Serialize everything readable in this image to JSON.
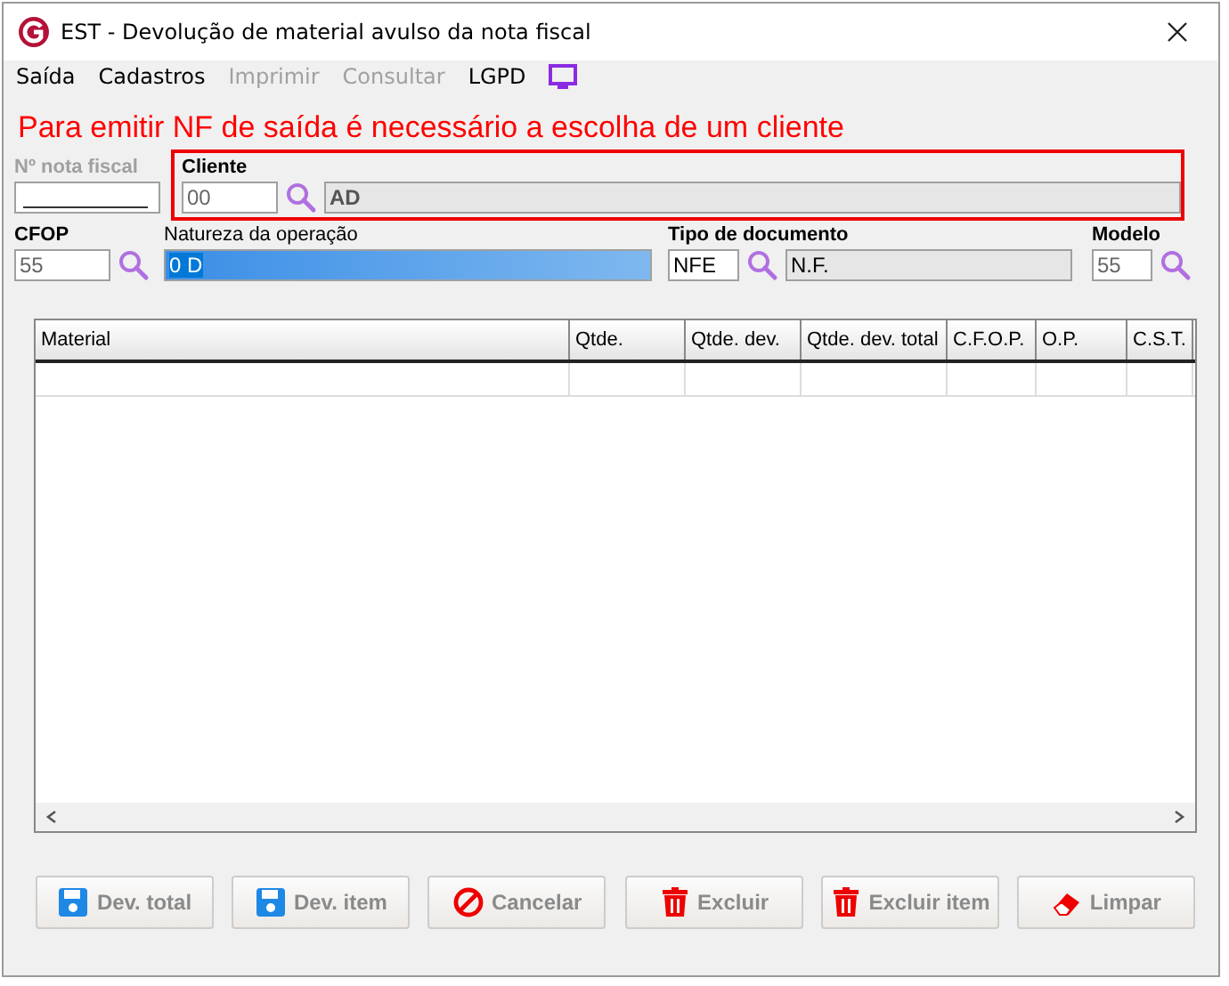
{
  "window": {
    "title": "EST - Devolução de material avulso da nota fiscal"
  },
  "menu": [
    {
      "label": "Saída",
      "disabled": false
    },
    {
      "label": "Cadastros",
      "disabled": false
    },
    {
      "label": "Imprimir",
      "disabled": true
    },
    {
      "label": "Consultar",
      "disabled": true
    },
    {
      "label": "LGPD",
      "disabled": false
    }
  ],
  "message": "Para emitir NF de saída é necessário a escolha de um cliente",
  "nota_fiscal": {
    "label": "Nº nota fiscal",
    "disabled": true
  },
  "cliente": {
    "label": "Cliente",
    "code": "00",
    "name": "AD"
  },
  "cfop": {
    "label": "CFOP",
    "value": "55"
  },
  "natureza": {
    "label": "Natureza da operação",
    "value": "0 D"
  },
  "tipo_documento": {
    "label": "Tipo de documento",
    "code": "NFE",
    "name": "N.F."
  },
  "modelo": {
    "label": "Modelo",
    "value": "55"
  },
  "table": {
    "columns": [
      "Material",
      "Qtde.",
      "Qtde. dev.",
      "Qtde. dev. total",
      "C.F.O.P.",
      "O.P.",
      "C.S.T."
    ]
  },
  "buttons": [
    {
      "label": "Dev. total",
      "kind": "save",
      "disabled": true
    },
    {
      "label": "Dev. item",
      "kind": "save",
      "disabled": true
    },
    {
      "label": "Cancelar",
      "kind": "cancel",
      "disabled": true
    },
    {
      "label": "Excluir",
      "kind": "delete",
      "disabled": true
    },
    {
      "label": "Excluir item",
      "kind": "delete",
      "disabled": true
    },
    {
      "label": "Limpar",
      "kind": "eraser",
      "disabled": true
    }
  ]
}
